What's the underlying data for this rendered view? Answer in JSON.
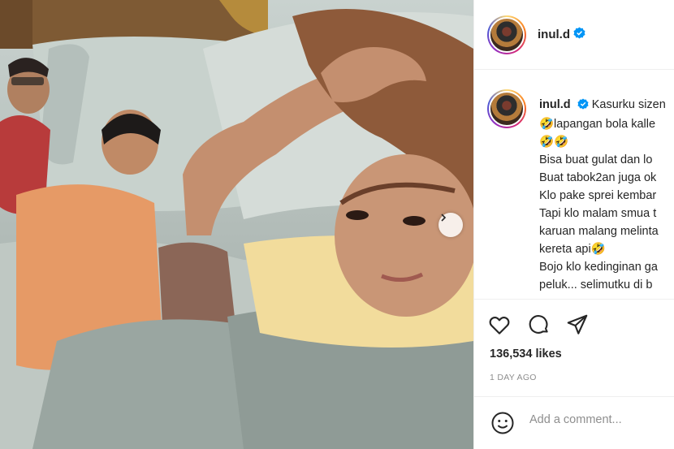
{
  "post": {
    "username": "inul.d",
    "caption_username": "inul.d",
    "caption_lines": [
      "Kasurku sizen",
      "🤣lapangan bola kalle",
      "🤣🤣",
      "Bisa buat gulat dan lo",
      "Buat tabok2an juga ok",
      "Klo pake sprei kembar",
      "Tapi klo malam smua t",
      "karuan malang melinta",
      "kereta api🤣",
      "Bojo klo kedinginan ga",
      "peluk... selimutku di b"
    ],
    "likes": "136,534 likes",
    "time": "1 DAY AGO",
    "comment_placeholder": "Add a comment...",
    "icons": [
      "heart-icon",
      "comment-icon",
      "share-icon",
      "emoji-icon",
      "chevron-right-icon",
      "verified-badge-icon"
    ],
    "colors": {
      "verified": "#0095f6",
      "muted": "#8e8e8e",
      "text": "#262626"
    }
  }
}
